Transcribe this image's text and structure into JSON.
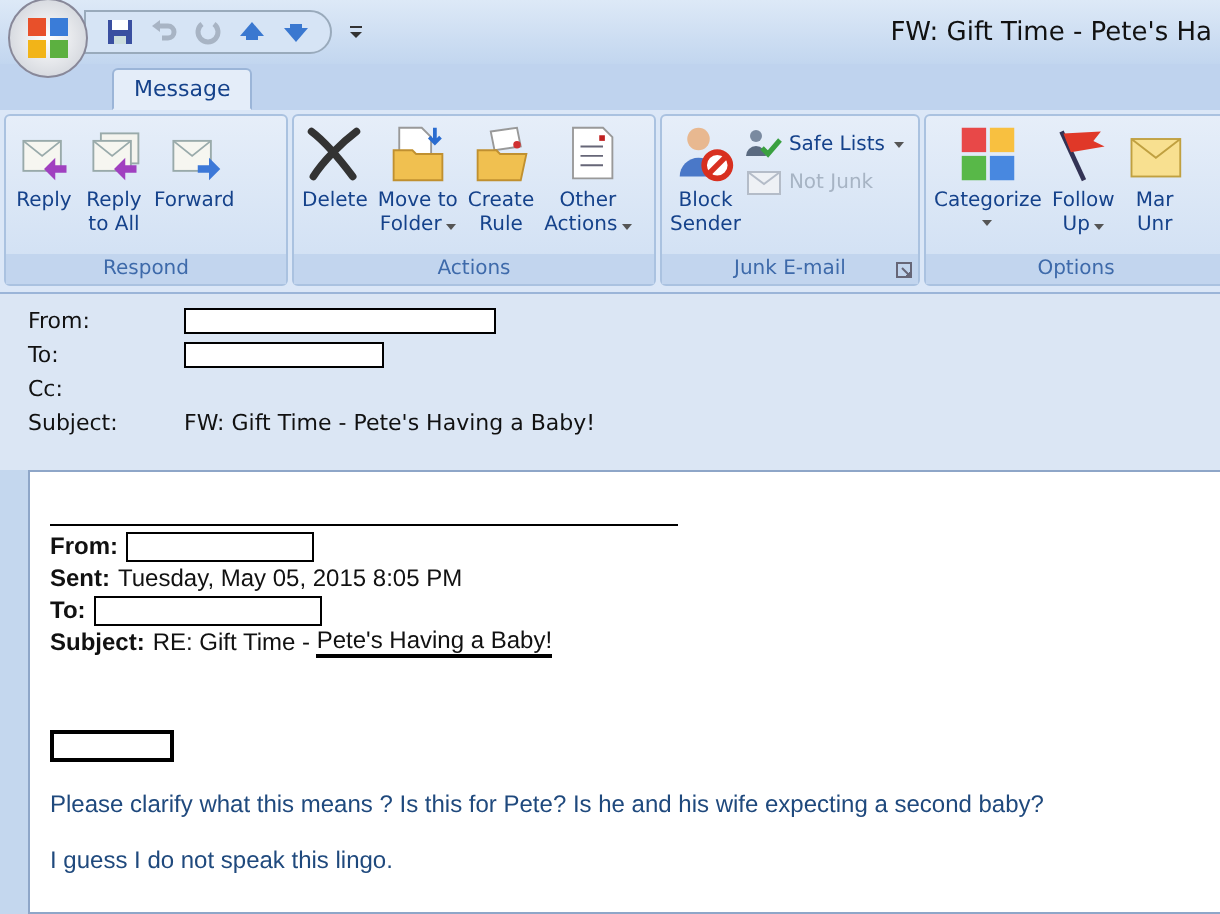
{
  "window": {
    "title": "FW: Gift Time - Pete's Ha"
  },
  "tabs": [
    {
      "label": "Message",
      "selected": true
    }
  ],
  "ribbon_groups": [
    {
      "label": "Respond",
      "buttons": [
        {
          "kind": "reply",
          "lines": [
            "Reply"
          ]
        },
        {
          "kind": "reply-all",
          "lines": [
            "Reply",
            "to All"
          ]
        },
        {
          "kind": "forward",
          "lines": [
            "Forward"
          ]
        }
      ]
    },
    {
      "label": "Actions",
      "buttons": [
        {
          "kind": "delete",
          "lines": [
            "Delete"
          ]
        },
        {
          "kind": "move",
          "lines": [
            "Move to",
            "Folder"
          ],
          "dropdown": true
        },
        {
          "kind": "rule",
          "lines": [
            "Create",
            "Rule"
          ]
        },
        {
          "kind": "other",
          "lines": [
            "Other",
            "Actions"
          ],
          "dropdown": true
        }
      ]
    },
    {
      "label": "Junk E-mail",
      "launcher": true,
      "buttons": [
        {
          "kind": "block",
          "lines": [
            "Block",
            "Sender"
          ]
        },
        {
          "kind": "small",
          "items": [
            {
              "kind": "safe",
              "label": "Safe Lists",
              "dropdown": true,
              "disabled": false
            },
            {
              "kind": "notjunk",
              "label": "Not Junk",
              "disabled": true
            }
          ]
        }
      ]
    },
    {
      "label": "Options",
      "buttons": [
        {
          "kind": "categorize",
          "lines": [
            "Categorize"
          ],
          "dropdown": true
        },
        {
          "kind": "flag",
          "lines": [
            "Follow",
            "Up"
          ],
          "dropdown": true
        },
        {
          "kind": "mark",
          "lines": [
            "Mar",
            "Unr"
          ]
        }
      ]
    }
  ],
  "header_fields": [
    {
      "label": "From:",
      "redacted": true
    },
    {
      "label": "To:",
      "redacted": true
    },
    {
      "label": "Cc:"
    },
    {
      "label": "Subject:",
      "value": "FW: Gift Time - Pete's Having a Baby!"
    }
  ],
  "forwarded_header": [
    {
      "label": "From:",
      "redacted": true
    },
    {
      "label": "Sent:",
      "value": "Tuesday, May 05, 2015 8:05 PM"
    },
    {
      "label": "To:",
      "redacted": true
    },
    {
      "label": "Subject:",
      "value": "RE: Gift Time - ",
      "underlined": "Pete's Having a Baby!"
    }
  ],
  "signature_redacted": true,
  "paragraphs": [
    "Please clarify what this means ?  Is this for Pete?  Is he and his wife expecting a second baby?",
    "I guess I do not speak this lingo."
  ]
}
